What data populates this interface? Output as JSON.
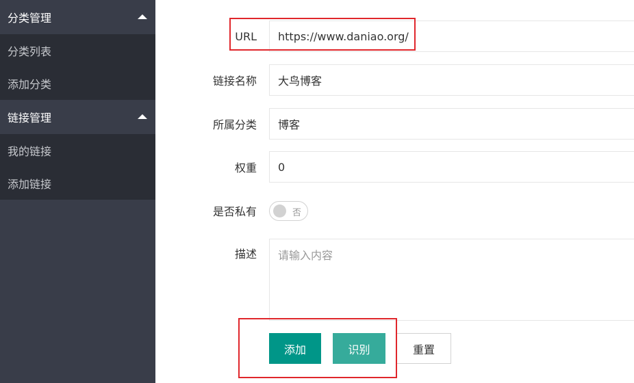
{
  "sidebar": {
    "groups": [
      {
        "title": "分类管理",
        "items": [
          "分类列表",
          "添加分类"
        ]
      },
      {
        "title": "链接管理",
        "items": [
          "我的链接",
          "添加链接"
        ]
      }
    ]
  },
  "form": {
    "url": {
      "label": "URL",
      "value": "https://www.daniao.org/"
    },
    "name": {
      "label": "链接名称",
      "value": "大鸟博客"
    },
    "category": {
      "label": "所属分类",
      "value": "博客"
    },
    "weight": {
      "label": "权重",
      "value": "0"
    },
    "private": {
      "label": "是否私有",
      "state_text": "否",
      "on": false
    },
    "description": {
      "label": "描述",
      "placeholder": "请输入内容"
    }
  },
  "buttons": {
    "add": "添加",
    "recognize": "识别",
    "reset": "重置"
  },
  "colors": {
    "sidebar_bg": "#393d49",
    "primary": "#009688",
    "highlight": "#e0262b"
  }
}
